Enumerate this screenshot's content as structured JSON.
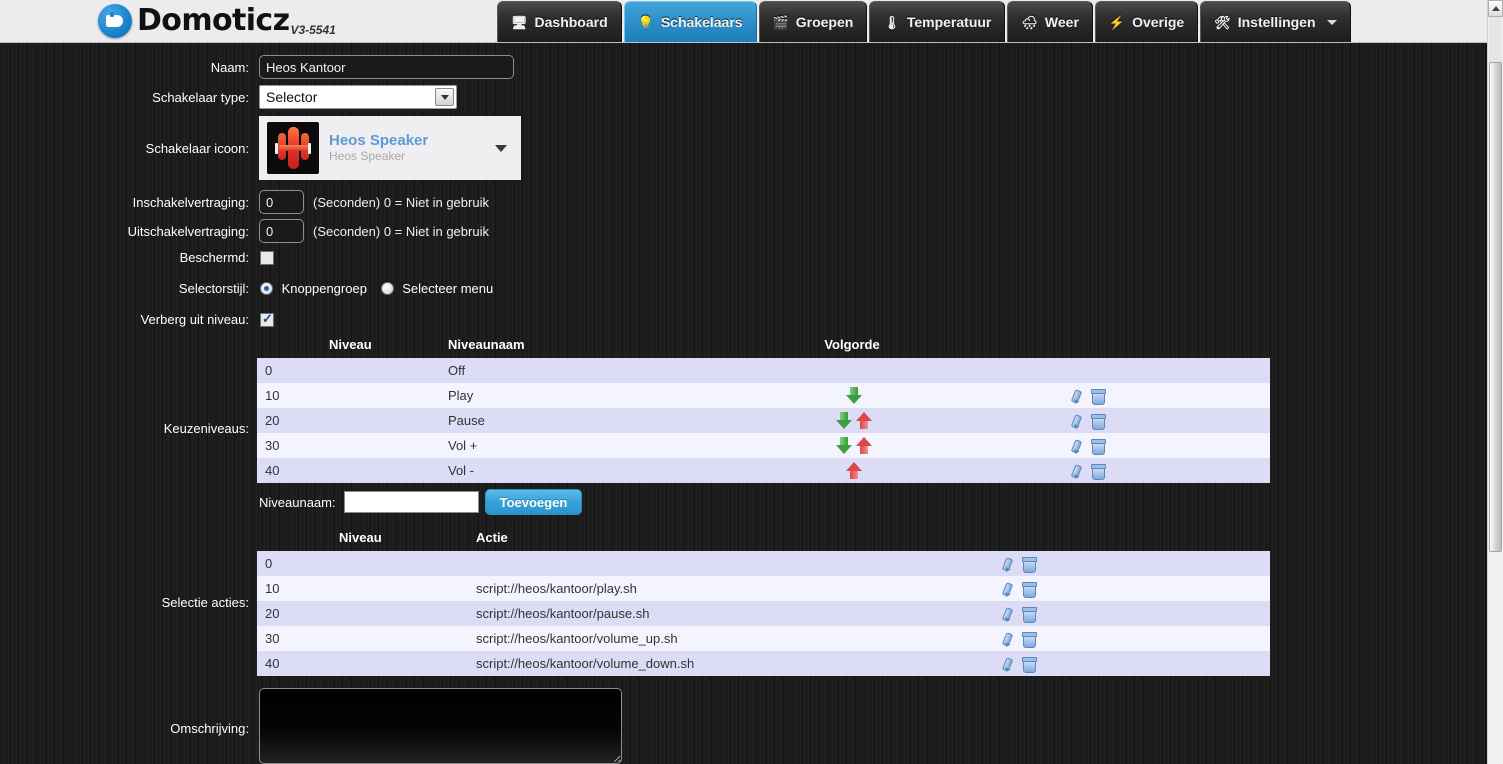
{
  "header": {
    "logo_text": "Domoticz",
    "version": "V3-5541",
    "nav": [
      {
        "label": "Dashboard",
        "icon": "monitor-icon",
        "glyph": "🖥",
        "active": false,
        "caret": false
      },
      {
        "label": "Schakelaars",
        "icon": "lightbulb-icon",
        "glyph": "💡",
        "active": true,
        "caret": false
      },
      {
        "label": "Groepen",
        "icon": "group-icon",
        "glyph": "🎬",
        "active": false,
        "caret": false
      },
      {
        "label": "Temperatuur",
        "icon": "thermometer-icon",
        "glyph": "🌡",
        "active": false,
        "caret": false
      },
      {
        "label": "Weer",
        "icon": "cloud-rain-icon",
        "glyph": "🌧",
        "active": false,
        "caret": false
      },
      {
        "label": "Overige",
        "icon": "lightning-icon",
        "glyph": "⚡",
        "active": false,
        "caret": false
      },
      {
        "label": "Instellingen",
        "icon": "tools-icon",
        "glyph": "🛠",
        "active": false,
        "caret": true
      }
    ]
  },
  "form": {
    "naam_label": "Naam:",
    "naam_value": "Heos Kantoor",
    "type_label": "Schakelaar type:",
    "type_value": "Selector",
    "icoon_label": "Schakelaar icoon:",
    "icoon_title": "Heos Speaker",
    "icoon_sub": "Heos Speaker",
    "on_delay_label": "Inschakelvertraging:",
    "on_delay_value": "0",
    "on_delay_hint": "(Seconden) 0 = Niet in gebruik",
    "off_delay_label": "Uitschakelvertraging:",
    "off_delay_value": "0",
    "off_delay_hint": "(Seconden) 0 = Niet in gebruik",
    "protected_label": "Beschermd:",
    "protected_checked": false,
    "selectorstyle_label": "Selectorstijl:",
    "selectorstyle_option_1": "Knoppengroep",
    "selectorstyle_option_2": "Selecteer menu",
    "selectorstyle_selected": "Knoppengroep",
    "hidelevel_label": "Verberg uit niveau:",
    "hidelevel_checked": true,
    "omschrijving_label": "Omschrijving:",
    "omschrijving_value": ""
  },
  "levels": {
    "section_label": "Keuzeniveaus:",
    "columns": [
      "Niveau",
      "Niveaunaam",
      "Volgorde"
    ],
    "rows": [
      {
        "niveau": "0",
        "naam": "Off",
        "can_down": false,
        "can_up": false,
        "has_actions": false
      },
      {
        "niveau": "10",
        "naam": "Play",
        "can_down": true,
        "can_up": false,
        "has_actions": true
      },
      {
        "niveau": "20",
        "naam": "Pause",
        "can_down": true,
        "can_up": true,
        "has_actions": true
      },
      {
        "niveau": "30",
        "naam": "Vol +",
        "can_down": true,
        "can_up": true,
        "has_actions": true
      },
      {
        "niveau": "40",
        "naam": "Vol -",
        "can_down": false,
        "can_up": true,
        "has_actions": true
      }
    ],
    "add_label": "Niveaunaam:",
    "add_value": "",
    "add_button": "Toevoegen"
  },
  "actions": {
    "section_label": "Selectie acties:",
    "columns": [
      "Niveau",
      "Actie"
    ],
    "rows": [
      {
        "niveau": "0",
        "actie": ""
      },
      {
        "niveau": "10",
        "actie": "script://heos/kantoor/play.sh"
      },
      {
        "niveau": "20",
        "actie": "script://heos/kantoor/pause.sh"
      },
      {
        "niveau": "30",
        "actie": "script://heos/kantoor/volume_up.sh"
      },
      {
        "niveau": "40",
        "actie": "script://heos/kantoor/volume_down.sh"
      }
    ]
  },
  "colors": {
    "accent": "#2e93cd",
    "row_odd": "#dcdcf7",
    "row_even": "#f4f4fe",
    "header_bg": "#ececec",
    "body_bg": "#1c1c1c"
  }
}
